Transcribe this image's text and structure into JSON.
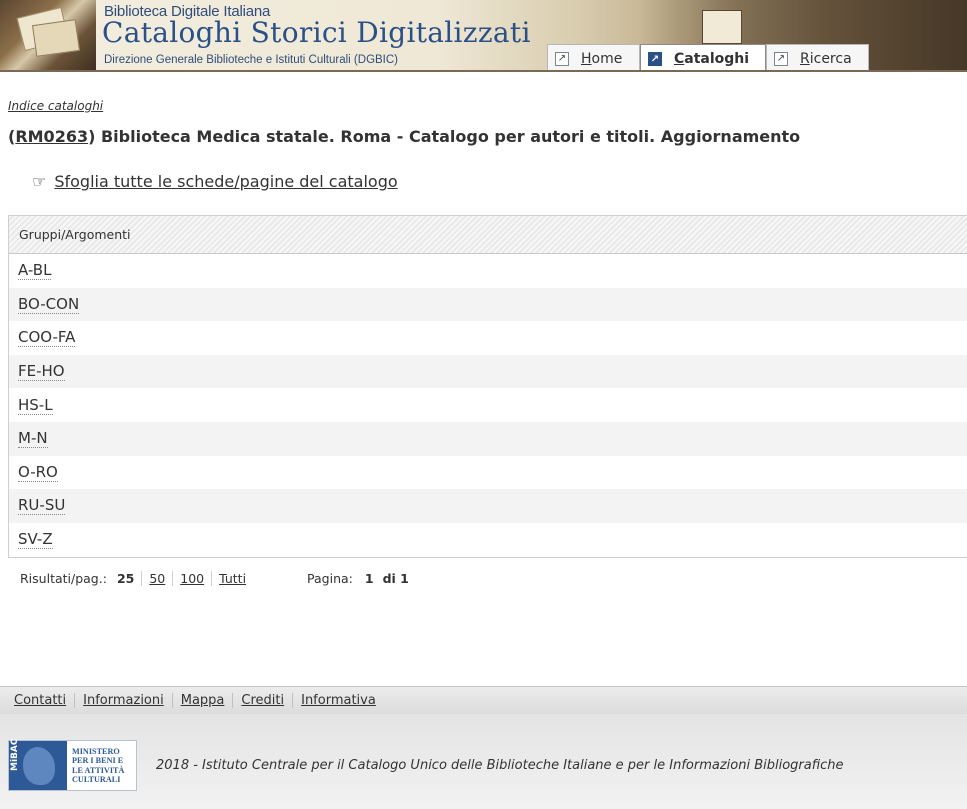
{
  "header": {
    "sup_title": "Biblioteca Digitale Italiana",
    "main_title": "Cataloghi Storici Digitalizzati",
    "sub_title": "Direzione Generale Biblioteche e Istituti Culturali (DGBIC)"
  },
  "nav": {
    "tabs": [
      {
        "first": "H",
        "rest": "ome",
        "icon": "arrow-icon",
        "active": false
      },
      {
        "first": "C",
        "rest": "ataloghi",
        "icon": "arrow-icon",
        "active": true
      },
      {
        "first": "R",
        "rest": "icerca",
        "icon": "arrow-icon",
        "active": false
      }
    ]
  },
  "breadcrumb": "Indice cataloghi",
  "catalog": {
    "open_paren": "(",
    "code": "RM0263",
    "title_rest": ") Biblioteca Medica statale. Roma - Catalogo per autori e titoli. Aggiornamento"
  },
  "browse": {
    "icon": "pointing-hand-icon",
    "icon_glyph": "☞",
    "label": "Sfoglia tutte le schede/pagine del catalogo"
  },
  "groups": {
    "header": "Gruppi/Argomenti",
    "rows": [
      "A-BL",
      "BO-CON",
      "COO-FA",
      "FE-HO",
      "HS-L",
      "M-N",
      "O-RO",
      "RU-SU",
      "SV-Z"
    ]
  },
  "pager": {
    "results_label": "Risultati/pag.:",
    "options": [
      "25",
      "50",
      "100",
      "Tutti"
    ],
    "selected": "25",
    "page_label": "Pagina:",
    "page_current": "1",
    "page_of": "di 1"
  },
  "footer": {
    "links": [
      "Contatti",
      "Informazioni",
      "Mappa",
      "Crediti",
      "Informativa"
    ],
    "logo_abbr": "MiBAC",
    "logo_text": [
      "MINISTERO",
      "PER I BENI E",
      "LE ATTIVITÀ",
      "CULTURALI"
    ],
    "copyright": "2018 - Istituto Centrale per il Catalogo Unico delle Biblioteche Italiane e per le Informazioni Bibliografiche"
  }
}
